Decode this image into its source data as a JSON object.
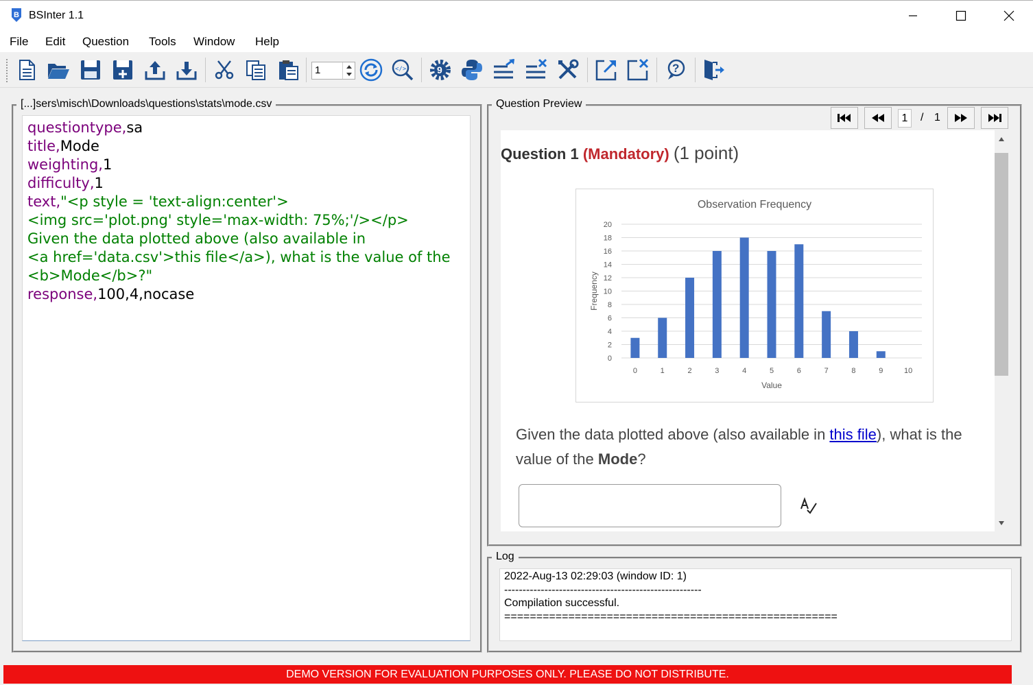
{
  "window": {
    "title": "BSInter 1.1"
  },
  "menu": [
    "File",
    "Edit",
    "Question",
    "Tools",
    "Window",
    "Help"
  ],
  "toolbar": {
    "spin_value": "1",
    "icons": [
      "new-file-icon",
      "open-folder-icon",
      "save-icon",
      "save-as-icon",
      "upload-icon",
      "download-icon",
      "cut-icon",
      "copy-icon",
      "paste-icon",
      "refresh-icon",
      "view-source-icon",
      "settings-icon",
      "python-icon",
      "export-icon",
      "close-list-icon",
      "tools-icon",
      "external-link-icon",
      "close-window-icon",
      "help-icon",
      "exit-icon"
    ]
  },
  "editor": {
    "path_label": "[...]sers\\misch\\Downloads\\questions\\stats\\mode.csv",
    "lines": [
      {
        "key": "questiontype,",
        "value": "sa",
        "kind": "kv"
      },
      {
        "key": "title,",
        "value": "Mode",
        "kind": "kv"
      },
      {
        "key": "weighting,",
        "value": "1",
        "kind": "kv"
      },
      {
        "key": "difficulty,",
        "value": "1",
        "kind": "kv"
      },
      {
        "key": "text,",
        "value": "\"<p style = 'text-align:center'>",
        "kind": "text"
      },
      {
        "key": "",
        "value": "<img src='plot.png' style='max-width: 75%;'/></p>",
        "kind": "str"
      },
      {
        "key": "",
        "value": "Given the data plotted above (also available in",
        "kind": "str"
      },
      {
        "key": "",
        "value": "<a href='data.csv'>this file</a>), what is the value of the",
        "kind": "str"
      },
      {
        "key": "",
        "value": "<b>Mode</b>?\"",
        "kind": "str"
      },
      {
        "key": "response,",
        "value": "100,4,nocase",
        "kind": "kv"
      }
    ]
  },
  "preview": {
    "label": "Question Preview",
    "page_current": "1",
    "page_sep": "/",
    "page_total": "1",
    "question_num": "Question 1",
    "mandatory": "(Mandatory)",
    "points": "(1 point)",
    "text_before_link": "Given the data plotted above (also available in ",
    "link_text": "this file",
    "text_after_link": "), what is the value of the ",
    "bold_word": "Mode",
    "text_end": "?",
    "answer_value": ""
  },
  "chart_data": {
    "type": "bar",
    "title": "Observation Frequency",
    "xlabel": "Value",
    "ylabel": "Frequency",
    "categories": [
      "0",
      "1",
      "2",
      "3",
      "4",
      "5",
      "6",
      "7",
      "8",
      "9",
      "10"
    ],
    "values": [
      3,
      6,
      12,
      16,
      18,
      16,
      17,
      7,
      4,
      1,
      0
    ],
    "ylim": [
      0,
      20
    ],
    "yticks": [
      0,
      2,
      4,
      6,
      8,
      10,
      12,
      14,
      16,
      18,
      20
    ],
    "bar_color": "#4472c4",
    "grid": true
  },
  "log": {
    "label": "Log",
    "lines": [
      "2022-Aug-13 02:29:03 (window ID: 1)",
      "------------------------------------------------------",
      "Compilation successful.",
      "===================================================="
    ]
  },
  "footer": {
    "demo_text": "DEMO VERSION FOR EVALUATION PURPOSES ONLY. PLEASE DO NOT DISTRIBUTE."
  },
  "colors": {
    "demo_bar": "#ee1111",
    "mandatory": "#c0272d",
    "keyword": "#7b007b",
    "string": "#008000"
  }
}
